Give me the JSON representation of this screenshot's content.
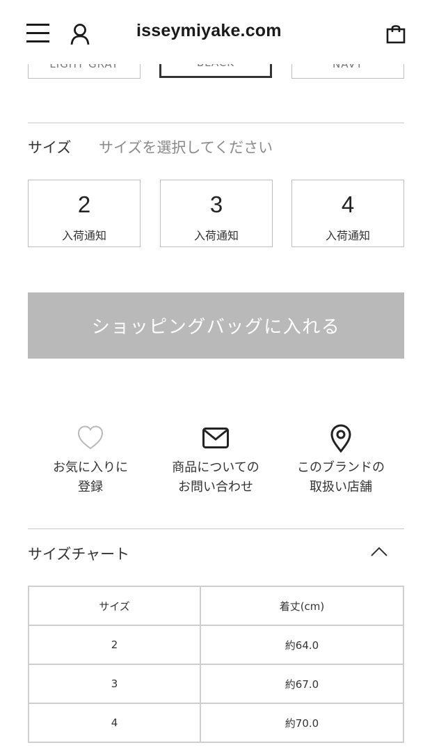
{
  "header": {
    "title": "isseymiyake.com",
    "menu_icon": "hamburger-menu-icon",
    "account_icon": "user-icon",
    "bag_icon": "shopping-bag-icon"
  },
  "colors": {
    "swatches": [
      {
        "label": "LIGHT GRAY",
        "selected": false
      },
      {
        "label": "BLACK",
        "selected": true
      },
      {
        "label": "NAVY",
        "selected": false
      }
    ]
  },
  "size": {
    "label": "サイズ",
    "hint": "サイズを選択してください",
    "options": [
      {
        "value": "2",
        "notify": "入荷通知"
      },
      {
        "value": "3",
        "notify": "入荷通知"
      },
      {
        "value": "4",
        "notify": "入荷通知"
      }
    ]
  },
  "cart": {
    "add_label": "ショッピングバッグに入れる",
    "button_color": "#b9b9b9"
  },
  "actions": [
    {
      "icon": "heart-icon",
      "label": "お気に入りに\n登録"
    },
    {
      "icon": "mail-icon",
      "label": "商品についての\nお問い合わせ"
    },
    {
      "icon": "map-pin-icon",
      "label": "このブランドの\n取扱い店舗"
    }
  ],
  "size_chart": {
    "title": "サイズチャート",
    "toggle_icon": "chevron-up-icon",
    "headers": [
      "サイズ",
      "着丈(cm)"
    ],
    "rows": [
      [
        "2",
        "約64.0"
      ],
      [
        "3",
        "約67.0"
      ],
      [
        "4",
        "約70.0"
      ]
    ]
  }
}
